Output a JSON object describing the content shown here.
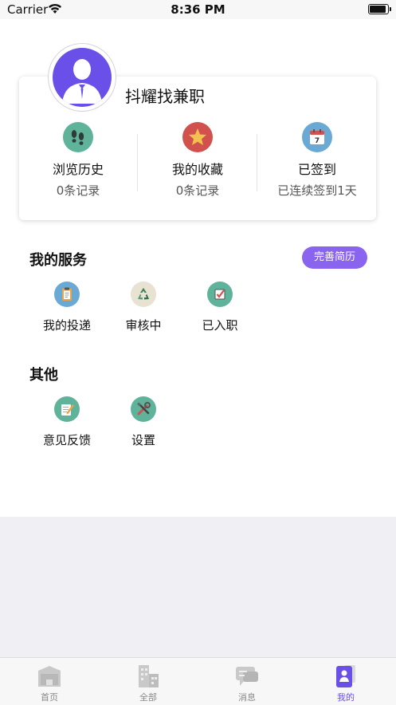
{
  "status_bar": {
    "carrier": "Carrier",
    "time": "8:36 PM"
  },
  "profile": {
    "username": "抖耀找兼职"
  },
  "stats": [
    {
      "label": "浏览历史",
      "sub": "0条记录",
      "icon": "footprints-icon",
      "color": "#5fb39a"
    },
    {
      "label": "我的收藏",
      "sub": "0条记录",
      "icon": "star-icon",
      "color": "#d0514d"
    },
    {
      "label": "已签到",
      "sub": "已连续签到1天",
      "icon": "calendar-icon",
      "color": "#6aa9d3"
    }
  ],
  "services": {
    "title": "我的服务",
    "resume_button": "完善简历",
    "items": [
      {
        "label": "我的投递",
        "icon": "clipboard-icon"
      },
      {
        "label": "审核中",
        "icon": "recycle-icon"
      },
      {
        "label": "已入职",
        "icon": "checkbox-icon"
      }
    ]
  },
  "other": {
    "title": "其他",
    "items": [
      {
        "label": "意见反馈",
        "icon": "edit-icon"
      },
      {
        "label": "设置",
        "icon": "tools-icon"
      }
    ]
  },
  "tabs": [
    {
      "label": "首页",
      "icon": "home-icon",
      "active": false
    },
    {
      "label": "全部",
      "icon": "buildings-icon",
      "active": false
    },
    {
      "label": "消息",
      "icon": "message-icon",
      "active": false
    },
    {
      "label": "我的",
      "icon": "profile-icon",
      "active": true
    }
  ],
  "colors": {
    "accent": "#6a4fe8",
    "button": "#8a64ee",
    "background": "#efeff4"
  }
}
